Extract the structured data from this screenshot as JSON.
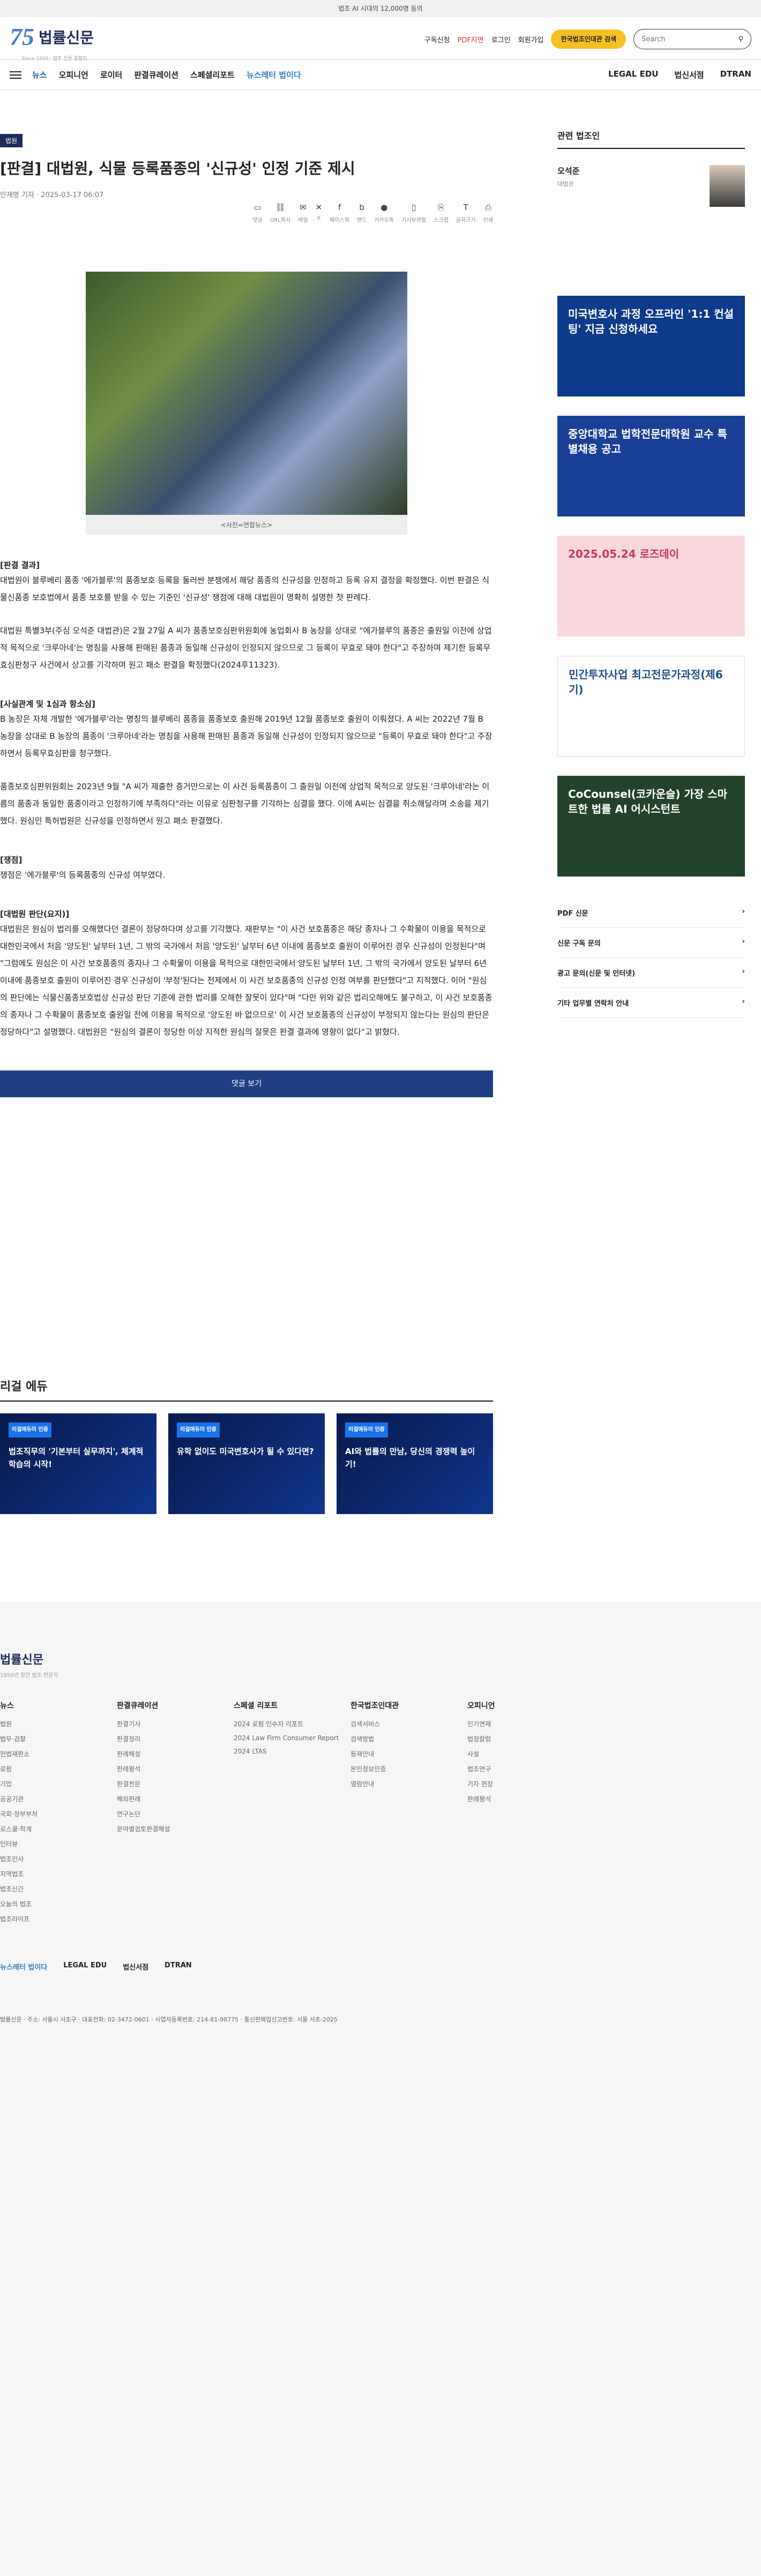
{
  "topbar": {
    "text": "법조 AI 시대의 12,000명 동의"
  },
  "header": {
    "logo_text": "법률신문",
    "logo_sub": "Since 1950 · 법조 전문 종합지",
    "subscribe": "구독신청",
    "pdf": "PDF지면",
    "login": "로그인",
    "join": "회원가입",
    "premium": "한국법조인대관 검색",
    "search_placeholder": "Search"
  },
  "nav": {
    "items": [
      "뉴스",
      "오피니언",
      "로이터",
      "판결큐레이션",
      "스페셜리포트",
      "뉴스레터 법이다"
    ],
    "right": [
      "LEGAL EDU",
      "법신서점",
      "DTRAN"
    ]
  },
  "article": {
    "category": "법원",
    "title": "[판결] 대법원, 식물 등록품종의 '신규성' 인정 기준 제시",
    "meta": "안재명 기자 · 2025-03-17 06:07",
    "tools": [
      "댓글",
      "URL복사",
      "메일",
      "X",
      "페이스북",
      "밴드",
      "카카오톡",
      "기사보관함",
      "스크랩",
      "글자크기",
      "인쇄"
    ],
    "caption": "<사진=연합뉴스>",
    "sections": [
      {
        "head": "[판결 결과]",
        "paras": [
          "대법원이 블루베리 품종 '에가블루'의 품종보호 등록을 둘러싼 분쟁에서 해당 품종의 신규성을 인정하고 등록 유지 결정을 확정했다. 이번 판결은 식물신품종 보호법에서 품종 보호를 받을 수 있는 기준인 '신규성' 쟁점에 대해 대법원이 명확히 설명한 첫 판례다.",
          "대법원 특별3부(주심 오석준 대법관)은 2월 27일 A 씨가 품종보호심판위원회에 농업회사 B 농장을 상대로 \"에가블루의 품종은 출원일 이전에 상업적 목적으로 '크루아네'는 명칭을 사용해 판매된 품종과 동일해 신규성이 인정되지 않으므로 그 등록이 무효로 돼야 한다\"고 주장하며 제기한 등록무효심판청구 사건에서 상고를 기각하며 원고 패소 판결을 확정했다(2024후11323)."
        ]
      },
      {
        "head": "[사실관계 및 1심과 항소심]",
        "paras": [
          "B 농장은 자체 개발한 '에가블루'라는 명칭의 블루베리 품종을 품종보호 출원해 2019년 12월 품종보호 출원이 이뤄졌다. A 씨는 2022년 7월 B 농장을 상대로 B 농장의 품종이 '크루아네'라는 명칭을 사용해 판매된 품종과 동일해 신규성이 인정되지 않으므로 \"등록이 무효로 돼야 한다\"고 주장하면서 등록무효심판을 청구했다.",
          "품종보호심판위원회는 2023년 9월 \"A 씨가 제출한 증거만으로는 이 사건 등록품종이 그 출원일 이전에 상업적 목적으로 양도된 '크루아네'라는 이름의 품종과 동일한 품종이라고 인정하기에 부족하다\"라는 이유로 심판청구를 기각하는 심결을 했다. 이에 A씨는 심결을 취소해달라며 소송을 제기했다. 원심인 특허법원은 신규성을 인정하면서 원고 패소 판결했다."
        ]
      },
      {
        "head": "[쟁점]",
        "paras": [
          "쟁점은 '에가블루'의 등록품종의 신규성 여부였다."
        ]
      },
      {
        "head": "[대법원 판단(요지)]",
        "paras": [
          "대법원은 원심이 법리를 오해했다던 결론이 정당하다며 상고를 기각했다. 재판부는 \"이 사건 보호품종은 해당 종자나 그 수확물이 이용을 목적으로 대한민국에서 처음 '양도된' 날부터 1년, 그 밖의 국가에서 처음 '양도된' 날부터 6년 이내에 품종보호 출원이 이루어진 경우 신규성이 인정된다\"며 \"그럼에도 원심은 이 사건 보호품종의 종자나 그 수확물이 이용을 목적으로 대한민국에서 양도된 날부터 1년, 그 밖의 국가에서 양도된 날부터 6년 이내에 품종보호 출원이 이루어진 경우 신규성이 '부정'된다는 전제에서 이 사건 보호품종의 신규성 인정 여부를 판단했다\"고 지적했다. 이어 \"원심의 판단에는 식물신품종보호법상 신규성 판단 기준에 관한 법리를 오해한 잘못이 있다\"며 \"다만 위와 같은 법리오해에도 불구하고, 이 사건 보호품종의 종자나 그 수확물이 품종보호 출원일 전에 이용을 목적으로 '양도된 바 없으므로' 이 사건 보호품종의 신규성이 부정되지 않는다는 원심의 판단은 정당하다\"고 설명했다. 대법원은 \"원심의 결론이 정당한 이상 지적한 원심의 잘못은 판결 결과에 영향이 없다\"고 밝혔다."
        ]
      }
    ],
    "comment_button": "댓글 보기"
  },
  "edu": {
    "title": "리걸 에듀",
    "cards": [
      {
        "tag": "리걸에듀이 인증",
        "text": "법조직무의 '기본부터 실무까지', 체계적 학습의 시작!"
      },
      {
        "tag": "리걸에듀이 인증",
        "text": "유학 없이도 미국변호사가 될 수 있다면?"
      },
      {
        "tag": "리걸에듀이 인증",
        "text": "AI와 법률의 만남, 당신의 경쟁력 높이기!"
      }
    ]
  },
  "side": {
    "related": "관련 법조인",
    "author": "오석준",
    "author_role": "대법관",
    "banners": [
      {
        "text": "미국변호사 과정 오프라인 '1:1 컨설팅' 지금 신청하세요",
        "color": "#0d3a8a"
      },
      {
        "text": "중앙대학교 법학전문대학원 교수 특별채용 공고",
        "color": "#1a3f96"
      },
      {
        "text": "2025.05.24 로즈데이",
        "color": "#c73a55"
      },
      {
        "text": "민간투자사업 최고전문가과정(제6기)",
        "color": "#ffffff"
      },
      {
        "text": "CoCounsel(코카운슬) 가장 스마트한 법률 AI 어시스턴트",
        "color": "#22432a"
      }
    ],
    "links": [
      "PDF 신문",
      "신문 구독 문의",
      "광고 문의(신문 및 인터넷)",
      "기타 업무별 연락처 안내"
    ]
  },
  "footer": {
    "logo": "법률신문",
    "sub": "1950년 창간 법조 전문지",
    "cols": [
      {
        "h": "뉴스",
        "items": [
          "법원",
          "법무·검찰",
          "헌법재판소",
          "로펌",
          "기업",
          "공공기관",
          "국회·정부부처",
          "로스쿨·학계",
          "인터뷰",
          "법조인사",
          "지역법조",
          "법조신간",
          "오늘의 법조",
          "법조라이프"
        ]
      },
      {
        "h": "판결큐레이션",
        "items": [
          "판결기사",
          "판결정리",
          "판례해설",
          "판례평석",
          "판결전문",
          "해외판례",
          "연구논단",
          "분야별검토판결해설"
        ]
      },
      {
        "h": "스페셜 리포트",
        "items": [
          "2024 로펌 인수자 리포트",
          "2024 Law Firm Consumer Report",
          "2024 LTAS"
        ]
      },
      {
        "h": "한국법조인대관",
        "items": [
          "검색서비스",
          "검색방법",
          "등재안내",
          "본인정보인증",
          "열람안내"
        ]
      },
      {
        "h": "오피니언",
        "items": [
          "인기연재",
          "법정칼럼",
          "사설",
          "법조연구",
          "기자 현장",
          "판례평석"
        ]
      }
    ],
    "bottom": [
      "뉴스레터 법이다",
      "LEGAL EDU",
      "법신서점",
      "DTRAN"
    ],
    "info": "법률신문 · 주소: 서울시 서초구 · 대표전화: 02-3472-0601 · 사업자등록번호: 214-81-98775 · 통신판매업신고번호: 서울 서초-2025"
  }
}
